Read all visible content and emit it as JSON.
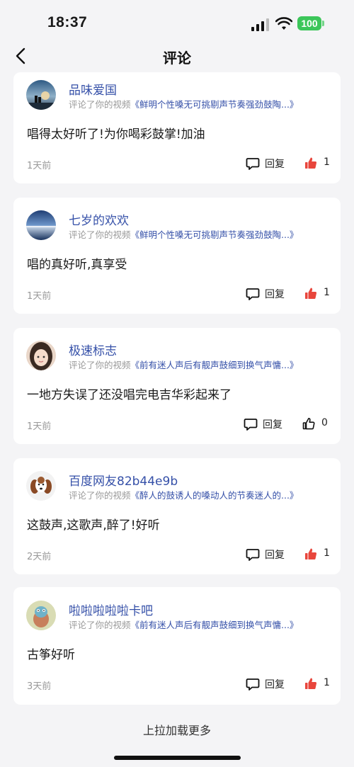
{
  "status_bar": {
    "time": "18:37",
    "battery": "100"
  },
  "nav": {
    "title": "评论"
  },
  "comments": [
    {
      "username": "品味爱国",
      "ref_prefix": "评论了你的视频",
      "video_title": "《鲜明个性嗓无可挑剔声节奏强劲鼓陶...》",
      "text": "唱得太好听了!为你喝彩鼓掌!加油",
      "time": "1天前",
      "reply_label": "回复",
      "likes": "1",
      "liked": true,
      "avatar": "avatar-sunset-couple"
    },
    {
      "username": "七岁的欢欢",
      "ref_prefix": "评论了你的视频",
      "video_title": "《鲜明个性嗓无可挑剔声节奏强劲鼓陶...》",
      "text": "唱的真好听,真享受",
      "time": "1天前",
      "reply_label": "回复",
      "likes": "1",
      "liked": true,
      "avatar": "avatar-lake"
    },
    {
      "username": "极速标志",
      "ref_prefix": "评论了你的视频",
      "video_title": "《前有迷人声后有靓声鼓细到换气声慵...》",
      "text": "一地方失误了还没唱完电吉华彩起来了",
      "time": "1天前",
      "reply_label": "回复",
      "likes": "0",
      "liked": false,
      "avatar": "avatar-girl"
    },
    {
      "username": "百度网友82b44e9b",
      "ref_prefix": "评论了你的视频",
      "video_title": "《醉人的鼓诱人的嗓动人的节奏迷人的...》",
      "text": "这鼓声,这歌声,醉了!好听",
      "time": "2天前",
      "reply_label": "回复",
      "likes": "1",
      "liked": true,
      "avatar": "avatar-dog"
    },
    {
      "username": "啦啦啦啦啦卡吧",
      "ref_prefix": "评论了你的视频",
      "video_title": "《前有迷人声后有靓声鼓细到换气声慵...》",
      "text": "古筝好听",
      "time": "3天前",
      "reply_label": "回复",
      "likes": "1",
      "liked": true,
      "avatar": "avatar-cartoon"
    }
  ],
  "footer": {
    "load_more": "上拉加载更多"
  },
  "colors": {
    "accent_blue": "#3550a8",
    "like_red": "#e8463c",
    "battery_green": "#3cc65a"
  }
}
